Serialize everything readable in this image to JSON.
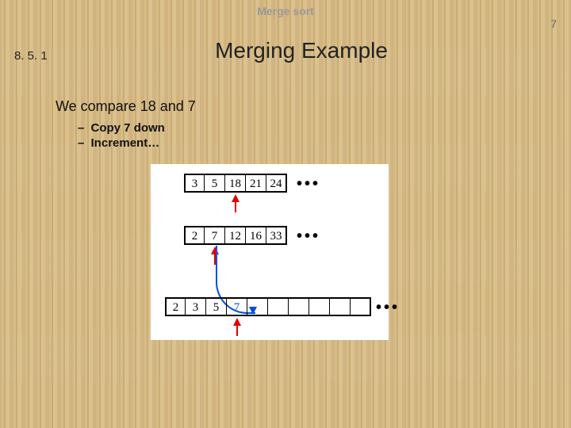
{
  "header": {
    "title": "Merge sort"
  },
  "page_number": "7",
  "section_number": "8. 5. 1",
  "slide_title": "Merging Example",
  "body_text": "We compare 18 and 7",
  "bullets": {
    "b0": "Copy 7 down",
    "b1": "Increment…"
  },
  "arrays": {
    "a": {
      "c0": "3",
      "c1": "5",
      "c2": "18",
      "c3": "21",
      "c4": "24"
    },
    "b": {
      "c0": "2",
      "c1": "7",
      "c2": "12",
      "c3": "16",
      "c4": "33"
    },
    "out_len": 10,
    "out": {
      "c0": "2",
      "c1": "3",
      "c2": "5",
      "c3": "7"
    }
  },
  "pointers": {
    "a_index": 2,
    "b_index": 1,
    "out_index": 3
  },
  "ellipsis": "•••"
}
